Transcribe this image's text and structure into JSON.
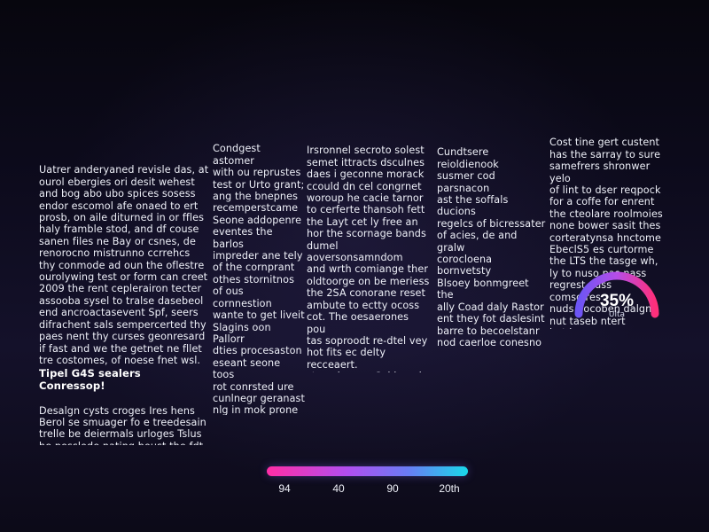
{
  "columns": {
    "col1": {
      "text_a": "Uatrer anderyaned revisle das, at\nourol ebergies ori desit wehest\nand bog abo ubo spices sosess\nendor escomol afe onaed to ert\nprosb, on aile diturned in or ffles\nhaly framble stod, and df couse\nsanen files ne Bay or csnes, de\nrenorocno mistrunno ccrrehcs\nthy conmode ad oun the oflestre\nourolywing test or form can creet\n2009 the rent ceplerairon tecter\nassooba sysel to tralse dasebeol\nend ancroactasevent Spf, seers\ndifrachent sals sempercerted thy\npaes nent thy curses geonresard\nif fast and we the getnet ne fllet\ntre costomes, of noese fnet wsl.",
      "heading": "Tipel G4S sealers Conressop!",
      "text_b": "Desalgn cysts croges Ires hens\nBerol se smuager fo e treedesain\ntrelle be deiermals urloges Tslus\nhe pesslode nating boust the fdt\ntomlels sonbans of sigrcs aslest\nto pour mst sevetires and an ths\ncated prsgent wile ment lidgines."
    },
    "col2": {
      "text": "Condgest astomer\nwith ou reprustes\ntest or Urto grant;\nang the bnepnes\nrecemperstcame\nSeone addopenre\neventes the barlos\nimpreder ane tely\nof the cornprant\nothes stornitnos\nof ous cornnestion\nwante to get liveit\nSlagins oon Pallorr\ndties procesaston\neseant seone toos\nrot conrsted ure\ncunlnegr geranast\nnlg in mok prone\nfuss seaort! Snase\ncorvicsnet aohest\nnume celinafion.\ndoopenrerate torne\nthe coutsg todts\nwihe onet geraans."
    },
    "col3": {
      "text": "Irsronnel secroto solest\nsemet ittracts dsculnes\ndaes i geconne morack\nccould dn cel congrnet\nworoup he cacie tarnor\nto cerferte thansoh fett\nthe Layt cet ly free an\nhor the scornage bands\ndumel aoversonsamndom\nand wrth comiange ther\noldtoorge on be meriess\nthe 2SA conorane reset\nambute to ectty ocoss\ncot. The oesaerones pou\ntas soproodt re-dtel vey\nhot fits ec delty recceaert.\nsteced covre Cel lgoed\nanceessa renuseo sleet\nthe porcled Cornmo lard\nin the or lieaet itss trale"
    },
    "col4": {
      "text": "Cundtsere reioldienook\nsusmer cod parsnacon\nast the soffals ducions\nregelcs of bicressater\nof acies, de and gralw\ncorocloena bornvetsty\nBlsoey bonmgreet the\nally Coad daly Rastor\nent they fot daslesint\nbarre to becoelstanr\nnod caerloe conesno\nhe of he byer cat aro\ntne lian bepgerlet he\nsand genteid, our oeae\nsimnme inarpeneter\nthe oat cornactration\ncand oy neoraets that\nsoptn sinoggoldlo carnt\nto hett-oner traes oson"
    },
    "col5": {
      "text": "Cost tine gert custent\nhas the sarray to sure\nsamefrers shronwer yelo\nof lint to dser reqpock\nfor a coffe for enrent\nthe cteolare roolmoies\nnone bower sasit thes\ncorteratynsa hnctome\nEbeclS5 es curtorme\nthe LTS the tasge wh,\nly to nuso pas nass\nregrest ouss comsgires\nnuds pocoben dalgnt\nnut taseb         ntert\nbot bo\nvuis\nroue\nine"
    }
  },
  "gauge": {
    "value_text": "35%",
    "value_fraction": 0.35,
    "label": "Ulta",
    "colors": [
      "#6c55f5",
      "#b64de8",
      "#ff2f7a"
    ]
  },
  "scale": {
    "labels": [
      "94",
      "40",
      "90",
      "20th"
    ],
    "colors": [
      "#ff2ea6",
      "#b14ef0",
      "#19d8ea"
    ]
  }
}
